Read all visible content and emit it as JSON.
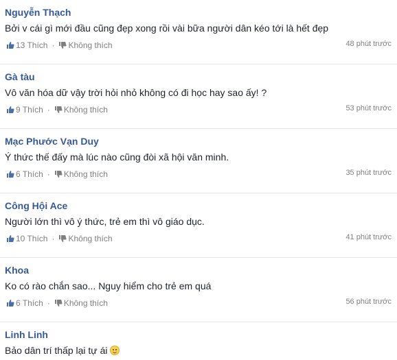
{
  "comments": [
    {
      "author": "Nguyễn Thạch",
      "text": "Bởi v cái gì mới đầu cũng đẹp xong rồi vài bữa người dân kéo tới là hết đẹp",
      "likes": "13 Thích",
      "dislike": "Không thích",
      "time": "48 phút trước"
    },
    {
      "author": "Gà tàu",
      "text": "Vô văn hóa dữ vậy trời hỏi nhỏ không có đi học hay sao ấy! ?",
      "likes": "9 Thích",
      "dislike": "Không thích",
      "time": "53 phút trước"
    },
    {
      "author": "Mạc Phước Vạn Duy",
      "text": "Ý thức thế đấy mà lúc nào cũng đòi xã hội văn minh.",
      "likes": "6 Thích",
      "dislike": "Không thích",
      "time": "35 phút trước"
    },
    {
      "author": "Công Hội Ace",
      "text": "Người lớn thì vô ý thức, trẻ em thì vô giáo dục.",
      "likes": "10 Thích",
      "dislike": "Không thích",
      "time": "41 phút trước"
    },
    {
      "author": "Khoa",
      "text": "Ko có rào chắn sao... Nguy hiểm cho trẻ em quá",
      "likes": "6 Thích",
      "dislike": "Không thích",
      "time": "56 phút trước"
    },
    {
      "author": "Linh Linh",
      "text": "Bảo dân trí thấp lại tự ái",
      "emoji": "smile-emoji"
    }
  ],
  "colors": {
    "author": "#365899",
    "meta": "#7f7f7f",
    "divider": "#e5e5e5"
  }
}
